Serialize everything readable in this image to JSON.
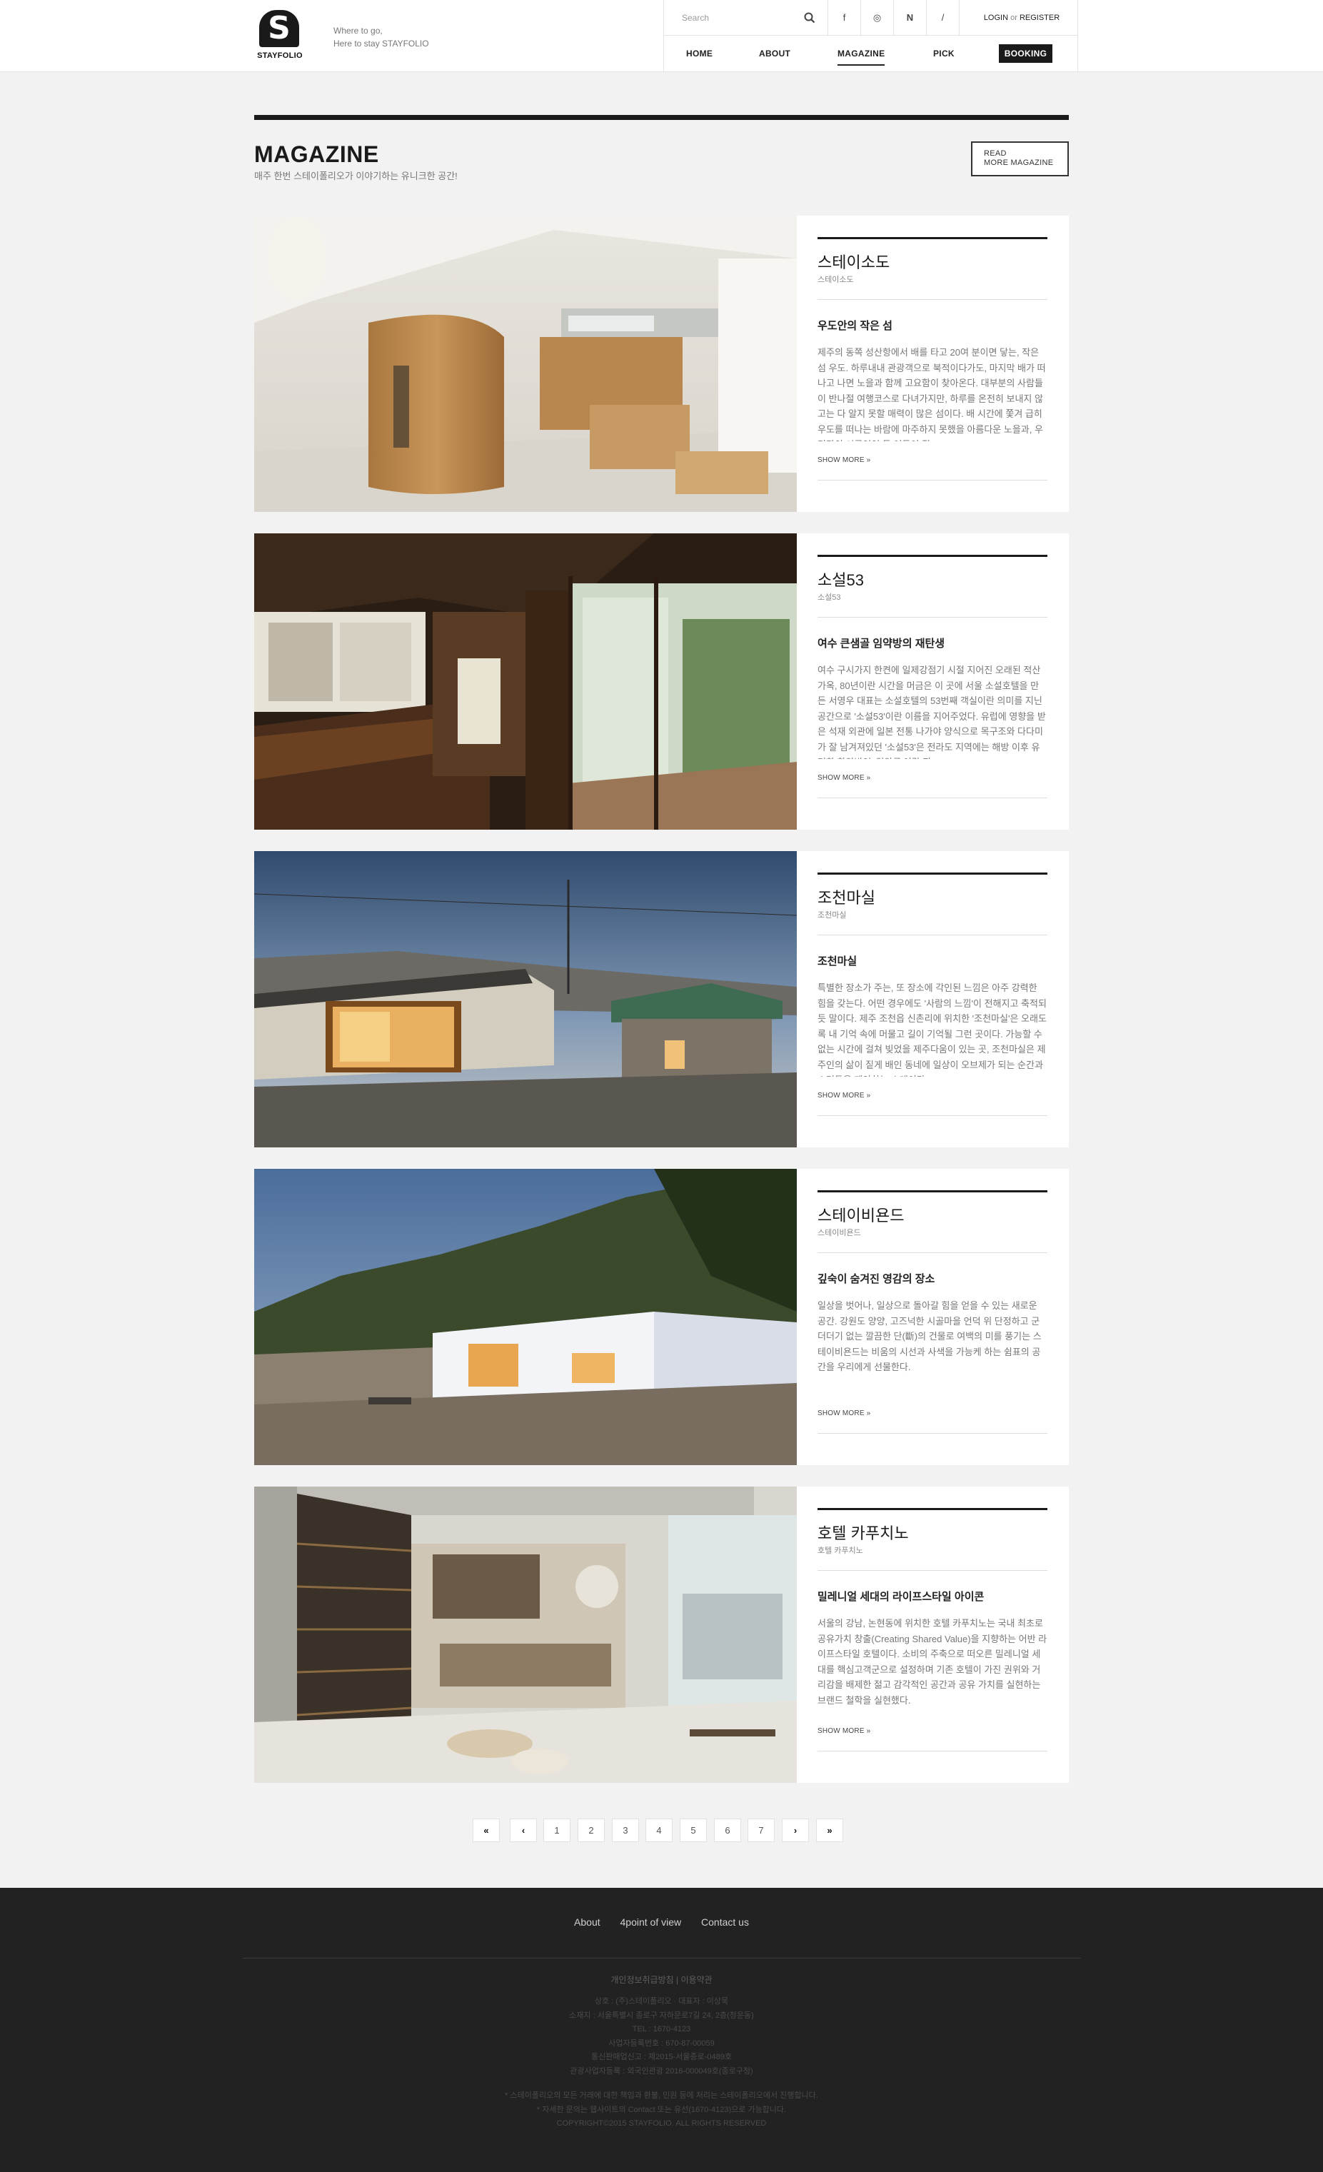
{
  "header": {
    "logo_text": "STAYFOLIO",
    "tagline_line1": "Where to go,",
    "tagline_line2": "Here to stay STAYFOLIO",
    "search_placeholder": "Search",
    "social": [
      "f",
      "◎",
      "N",
      "/"
    ],
    "login": "LOGIN",
    "or": "or",
    "register": "REGISTER",
    "nav": [
      "HOME",
      "ABOUT",
      "MAGAZINE",
      "PICK"
    ],
    "nav_active": "MAGAZINE",
    "booking": "BOOKING"
  },
  "section": {
    "title": "MAGAZINE",
    "subtitle": "매주 한번 스테이폴리오가 이야기하는 유니크한 공간!",
    "read_more_line1": "READ",
    "read_more_line2": "MORE MAGAZINE"
  },
  "cards": [
    {
      "name": "스테이소도",
      "sub": "스테이소도",
      "headline": "우도안의 작은 섬",
      "desc": "제주의 동쪽 성산항에서 배를 타고 20여 분이면 닿는, 작은 섬 우도. 하루내내 관광객으로 북적이다가도, 마지막 배가 떠나고 나면 노을과 함께 고요함이 찾아온다. 대부분의 사람들이 반나절 여행코스로 다녀가지만, 하루를 온전히 보내지 않고는 다 알지 못할 매력이 많은 섬이다. 배 시간에 쫓겨 급히 우도를 떠나는 바람에 마주하지 못했을 아름다운 노을과, 우리만의 시골인인 듯 어둠이 짙",
      "more": "SHOW MORE »"
    },
    {
      "name": "소설53",
      "sub": "소설53",
      "headline": "여수 큰샘골 임약방의 재탄생",
      "desc": "여수 구시가지 한켠에 일제강점기 시절 지어진 오래된 적산가옥, 80년이란 시간을 머금은 이 곳에 서울 소설호텔을 만든 서영우 대표는 소설호텔의 53번째 객실이란 의미를 지닌 공간으로 '소설53'이란 이름을 지어주었다. 유럽에 영향을 받은 석재 외관에 일본 전통 나가야 양식으로 목구조와 다다미가 잘 남겨져있던 '소설53'은 전라도 지역에는 해방 이후 유명한 한약방인 '임약국'이란 장",
      "more": "SHOW MORE »"
    },
    {
      "name": "조천마실",
      "sub": "조천마실",
      "headline": "조천마실",
      "desc": "특별한 장소가 주는, 또 장소에 각인된 느낌은 아주 강력한 힘을 갖는다. 어떤 경우에도 '사람의 느낌'이 전해지고 축적되듯 말이다. 제주 조천읍 신촌리에 위치한 '조천마실'은 오래도록 내 기억 속에 머물고 길이 기억될 그런 곳이다. 가능할 수 없는 시간에 걸쳐 빚었을 제주다움이 있는 곳, 조천마실은 제주인의 삶이 짙게 배인 동네에 일상이 오브제가 되는 순간과 스며듦을 제안하는 스테이다.",
      "more": "SHOW MORE »"
    },
    {
      "name": "스테이비욘드",
      "sub": "스테이비욘드",
      "headline": "깊숙이 숨겨진 영감의 장소",
      "desc": "일상을 벗어나, 일상으로 돌아갈 힘을 얻을 수 있는 새로운 공간. 강원도 양양, 고즈넉한 시골마을 언덕 위 단정하고 군더더기 없는 깔끔한 단(斷)의 건물로 여백의 미를 풍기는 스테이비욘드는 비움의 시선과 사색을 가능케 하는 쉼표의 공간을 우리에게 선물한다.",
      "more": "SHOW MORE »"
    },
    {
      "name": "호텔 카푸치노",
      "sub": "호텔 카푸치노",
      "headline": "밀레니얼 세대의 라이프스타일 아이콘",
      "desc": "서울의 강남, 논현동에 위치한 호텔 카푸치노는 국내 최초로 공유가치 창출(Creating Shared Value)을 지향하는 어반 라이프스타일 호텔이다. 소비의 주축으로 떠오른 밀레니얼 세대를 핵심고객군으로 설정하며 기존 호텔이 가진 권위와 거리감을 배제한 젊고 감각적인 공간과 공유 가치를 실현하는 브랜드 철학을 실현했다.",
      "more": "SHOW MORE »"
    }
  ],
  "pagination": [
    "«",
    "‹",
    "1",
    "2",
    "3",
    "4",
    "5",
    "6",
    "7",
    "›",
    "»"
  ],
  "footer": {
    "links": [
      "About",
      "4point of view",
      "Contact us"
    ],
    "policy": "개인정보취급방침 | 이용약관",
    "info": [
      "상호 : (주)스테이폴리오 · 대표자 : 이상묵",
      "소재지 : 서울특별시 종로구 자하문로7길 24, 2층(청운동)",
      "TEL : 1670-4123",
      "사업자등록번호 : 670-87-00059",
      "통신판매업신고 : 제2015-서울종로-0489호",
      "관광사업자등록 : 외국인관광 2016-000049호(종로구청)"
    ],
    "copyright": [
      "* 스테이폴리오의 모든 거래에 대한 책임과 환불, 민원 등에 처리는 스테이폴리오에서 진행합니다.",
      "* 자세한 문의는 웹사이트의 Contact 또는 유선(1670-4123)으로 가능합니다.",
      "COPYRIGHT©2015 STAYFOLIO. ALL RIGHTS RESERVED"
    ]
  }
}
